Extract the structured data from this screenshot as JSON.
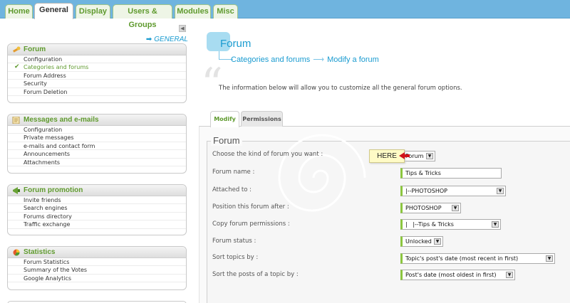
{
  "top_tabs": [
    {
      "label": "Home"
    },
    {
      "label": "General",
      "active": true
    },
    {
      "label": "Display"
    },
    {
      "label": "Users & Groups"
    },
    {
      "label": "Modules"
    },
    {
      "label": "Misc"
    }
  ],
  "sidebar": {
    "collapse_glyph": "◀",
    "section_label": "GENERAL",
    "panels": [
      {
        "title": "Forum",
        "icon": "wrench-icon",
        "items": [
          "Configuration",
          "Categories and forums",
          "Forum Address",
          "Security",
          "Forum Deletion"
        ],
        "current_index": 1
      },
      {
        "title": "Messages and e-mails",
        "icon": "notepad-icon",
        "items": [
          "Configuration",
          "Private messages",
          "e-mails and contact form",
          "Announcements",
          "Attachments"
        ]
      },
      {
        "title": "Forum promotion",
        "icon": "megaphone-icon",
        "items": [
          "Invite friends",
          "Search engines",
          "Forums directory",
          "Traffic exchange"
        ]
      },
      {
        "title": "Statistics",
        "icon": "pie-chart-icon",
        "items": [
          "Forum Statistics",
          "Summary of the Votes",
          "Google Analytics"
        ]
      }
    ]
  },
  "main": {
    "title": "Forum",
    "breadcrumb": [
      "Categories and forums",
      "Modify a forum"
    ],
    "info": "The information below will allow you to customize all the general forum options.",
    "tabs": [
      {
        "label": "Modify",
        "active": true
      },
      {
        "label": "Permissions"
      }
    ],
    "legend": "Forum",
    "fields": [
      {
        "label": "Choose the kind of forum you want :",
        "value": "Forum"
      },
      {
        "label": "Forum name :",
        "value": "Tips & Tricks"
      },
      {
        "label": "Attached to :",
        "value": "|--PHOTOSHOP"
      },
      {
        "label": "Position this forum after :",
        "value": "PHOTOSHOP"
      },
      {
        "label": "Copy forum permissions :",
        "value": "|   |--Tips & Tricks"
      },
      {
        "label": "Forum status :",
        "value": "Unlocked"
      },
      {
        "label": "Sort topics by :",
        "value": "Topic's post's date (most recent in first)"
      },
      {
        "label": "Sort the posts of a topic by :",
        "value": "Post's date (most oldest in first)"
      }
    ],
    "tooltip": "HERE"
  },
  "colors": {
    "accent_green": "#5f9a2e",
    "accent_blue": "#1a9bd0",
    "topbar_blue": "#6fb4df",
    "tooltip_yellow": "#fffbc6",
    "arrow_red": "#d0151b"
  }
}
